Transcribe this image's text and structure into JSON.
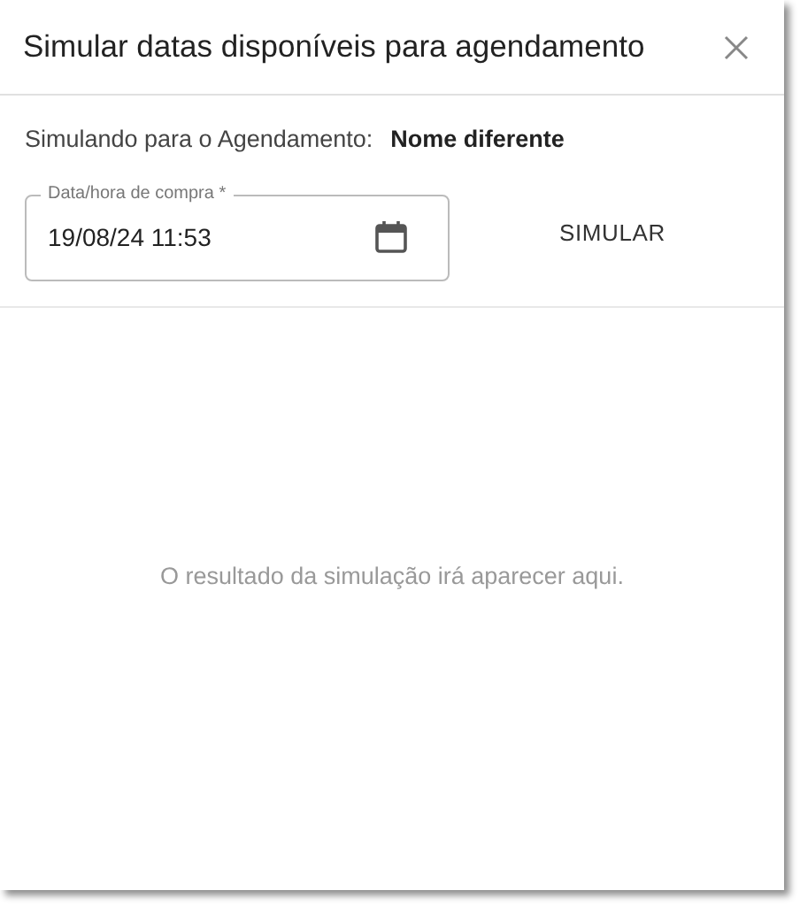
{
  "dialog": {
    "title": "Simular datas disponíveis para agendamento",
    "info": {
      "label": "Simulando para o Agendamento:",
      "value": "Nome diferente"
    },
    "field": {
      "label": "Data/hora de compra *",
      "value": "19/08/24 11:53"
    },
    "action": "SIMULAR",
    "empty_message": "O resultado da simulação irá aparecer aqui."
  }
}
